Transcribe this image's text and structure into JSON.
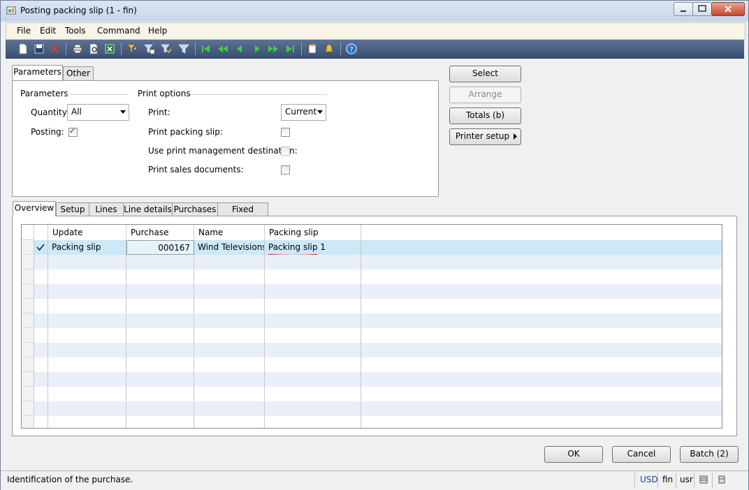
{
  "window": {
    "title": "Posting packing slip (1 - fin)"
  },
  "menu": [
    "File",
    "Edit",
    "Tools",
    "Command",
    "Help"
  ],
  "toolbar_icons": [
    "new-icon",
    "save-icon",
    "delete-icon",
    "print-icon",
    "print-preview-icon",
    "export-excel-icon",
    "filter-by-selection-icon",
    "filter-by-grid-icon",
    "advanced-filter-icon",
    "filter-icon",
    "first-record-icon",
    "previous-page-icon",
    "previous-record-icon",
    "next-record-icon",
    "next-page-icon",
    "last-record-icon",
    "document-handling-icon",
    "alert-icon",
    "help-icon"
  ],
  "top_tabs": [
    "Parameters",
    "Other"
  ],
  "parameters": {
    "group_title": "Parameters",
    "quantity_label": "Quantity:",
    "quantity_value": "All",
    "posting_label": "Posting:",
    "posting_checked": true
  },
  "print_options": {
    "group_title": "Print options",
    "print_label": "Print:",
    "print_value": "Current",
    "print_packing_slip_label": "Print packing slip:",
    "print_packing_slip_checked": false,
    "use_print_mgmt_label": "Use print management destination:",
    "use_print_mgmt_checked": false,
    "print_sales_docs_label": "Print sales documents:",
    "print_sales_docs_checked": false
  },
  "side_buttons": {
    "select": "Select",
    "arrange": "Arrange",
    "totals": "Totals (b)",
    "printer_setup": "Printer setup"
  },
  "bottom_tabs": [
    "Overview",
    "Setup",
    "Lines",
    "Line details",
    "Purchases",
    "Fixed assets"
  ],
  "grid": {
    "columns": [
      "Update",
      "Purchase order",
      "Name",
      "Packing slip"
    ],
    "rows": [
      {
        "update": "Packing slip",
        "purchase_order": "000167",
        "name": "Wind Televisions",
        "packing_slip": "Packing slip 1",
        "checked": true
      }
    ]
  },
  "dialog_buttons": {
    "ok": "OK",
    "cancel": "Cancel",
    "batch": "Batch (2)"
  },
  "status": {
    "text": "Identification of the purchase.",
    "currency": "USD",
    "company": "fin",
    "user": "usr"
  },
  "colors": {
    "selected_row": "#cde8f7",
    "alt_row": "#e9eff8",
    "annotation": "#d42020"
  }
}
